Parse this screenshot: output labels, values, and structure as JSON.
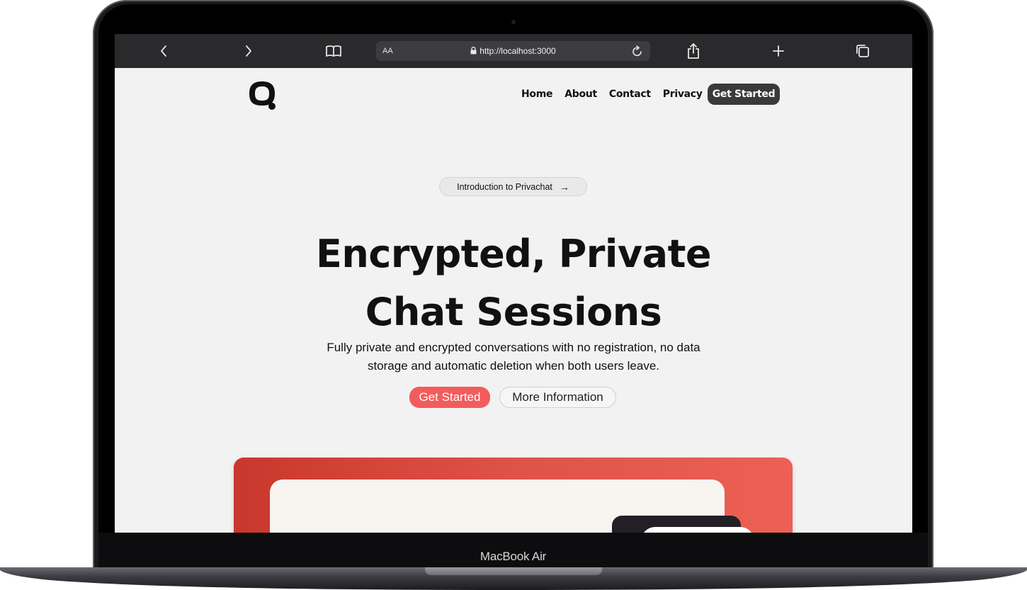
{
  "device": {
    "label": "MacBook Air"
  },
  "browser": {
    "back_icon": "chevron-left-icon",
    "forward_icon": "chevron-right-icon",
    "bookmarks_icon": "book-icon",
    "reader_label": "AA",
    "url": "http://localhost:3000",
    "lock_icon": "lock-icon",
    "reload_icon": "reload-icon",
    "share_icon": "share-icon",
    "new_tab_icon": "plus-icon",
    "tabs_icon": "tabs-icon"
  },
  "nav": {
    "logo": "Q-chat-logo",
    "links": [
      "Home",
      "About",
      "Contact",
      "Privacy"
    ],
    "cta": "Get Started"
  },
  "hero": {
    "pill_text": "Introduction to Privachat",
    "pill_arrow": "→",
    "headline_line1": "Encrypted, Private",
    "headline_line2": "Chat Sessions",
    "subtext_line1": "Fully private and encrypted conversations with no registration, no data",
    "subtext_line2": "storage and automatic deletion when both users leave.",
    "primary_button": "Get Started",
    "secondary_button": "More Information"
  },
  "preview": {
    "dots": "..."
  },
  "colors": {
    "accent": "#f35c5c",
    "nav_cta": "#3a3a3a",
    "page_background": "#f2f2f2",
    "panel_gradient_start": "#c9372c",
    "panel_gradient_end": "#ec6055"
  }
}
